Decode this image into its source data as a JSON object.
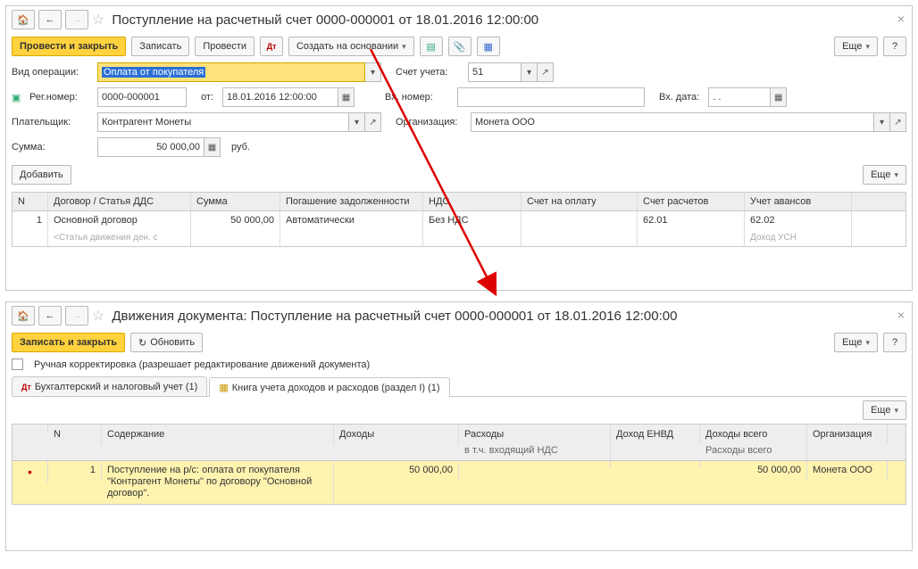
{
  "window1": {
    "title": "Поступление на расчетный счет 0000-000001 от 18.01.2016 12:00:00",
    "toolbar": {
      "post_close": "Провести и закрыть",
      "save": "Записать",
      "post": "Провести",
      "create_based": "Создать на основании",
      "more": "Еще"
    },
    "fields": {
      "op_type_label": "Вид операции:",
      "op_type_value": "Оплата от покупателя",
      "account_label": "Счет учета:",
      "account_value": "51",
      "regnum_label": "Рег.номер:",
      "regnum_value": "0000-000001",
      "date_label": "от:",
      "date_value": "18.01.2016 12:00:00",
      "extnum_label": "Вх. номер:",
      "extdate_label": "Вх. дата:",
      "extdate_value": ".  .",
      "payer_label": "Плательщик:",
      "payer_value": "Контрагент Монеты",
      "org_label": "Организация:",
      "org_value": "Монета ООО",
      "sum_label": "Сумма:",
      "sum_value": "50 000,00",
      "currency": "руб."
    },
    "subtoolbar": {
      "add": "Добавить",
      "more": "Еще"
    },
    "table": {
      "headers": {
        "n": "N",
        "contract": "Договор / Статья ДДС",
        "sum": "Сумма",
        "repay": "Погашение задолженности",
        "vat": "НДС",
        "invoice": "Счет на оплату",
        "calc_acc": "Счет расчетов",
        "adv_acc": "Учет авансов"
      },
      "row": {
        "n": "1",
        "contract": "Основной договор",
        "contract_sub": "<Статья движения ден. с",
        "sum": "50 000,00",
        "repay": "Автоматически",
        "vat": "Без НДС",
        "invoice": "",
        "calc_acc": "62.01",
        "adv_acc": "62.02",
        "adv_sub": "Доход УСН"
      }
    }
  },
  "window2": {
    "title": "Движения документа: Поступление на расчетный счет 0000-000001 от 18.01.2016 12:00:00",
    "toolbar": {
      "save_close": "Записать и закрыть",
      "refresh": "Обновить",
      "more": "Еще"
    },
    "manual_edit": "Ручная корректировка (разрешает редактирование движений документа)",
    "tabs": {
      "acc": "Бухгалтерский и налоговый учет (1)",
      "book": "Книга учета доходов и расходов (раздел I) (1)"
    },
    "more": "Еще",
    "table": {
      "headers": {
        "mark": "",
        "n": "N",
        "content": "Содержание",
        "income": "Доходы",
        "expense": "Расходы",
        "expense2": "в т.ч. входящий НДС",
        "envd": "Доход ЕНВД",
        "income_total": "Доходы всего",
        "expense_total": "Расходы всего",
        "org": "Организация"
      },
      "row": {
        "n": "1",
        "content": "Поступление на р/с: оплата от покупателя \"Контрагент Монеты\" по договору \"Основной договор\".",
        "income": "50 000,00",
        "income_total": "50 000,00",
        "org": "Монета ООО"
      }
    }
  }
}
